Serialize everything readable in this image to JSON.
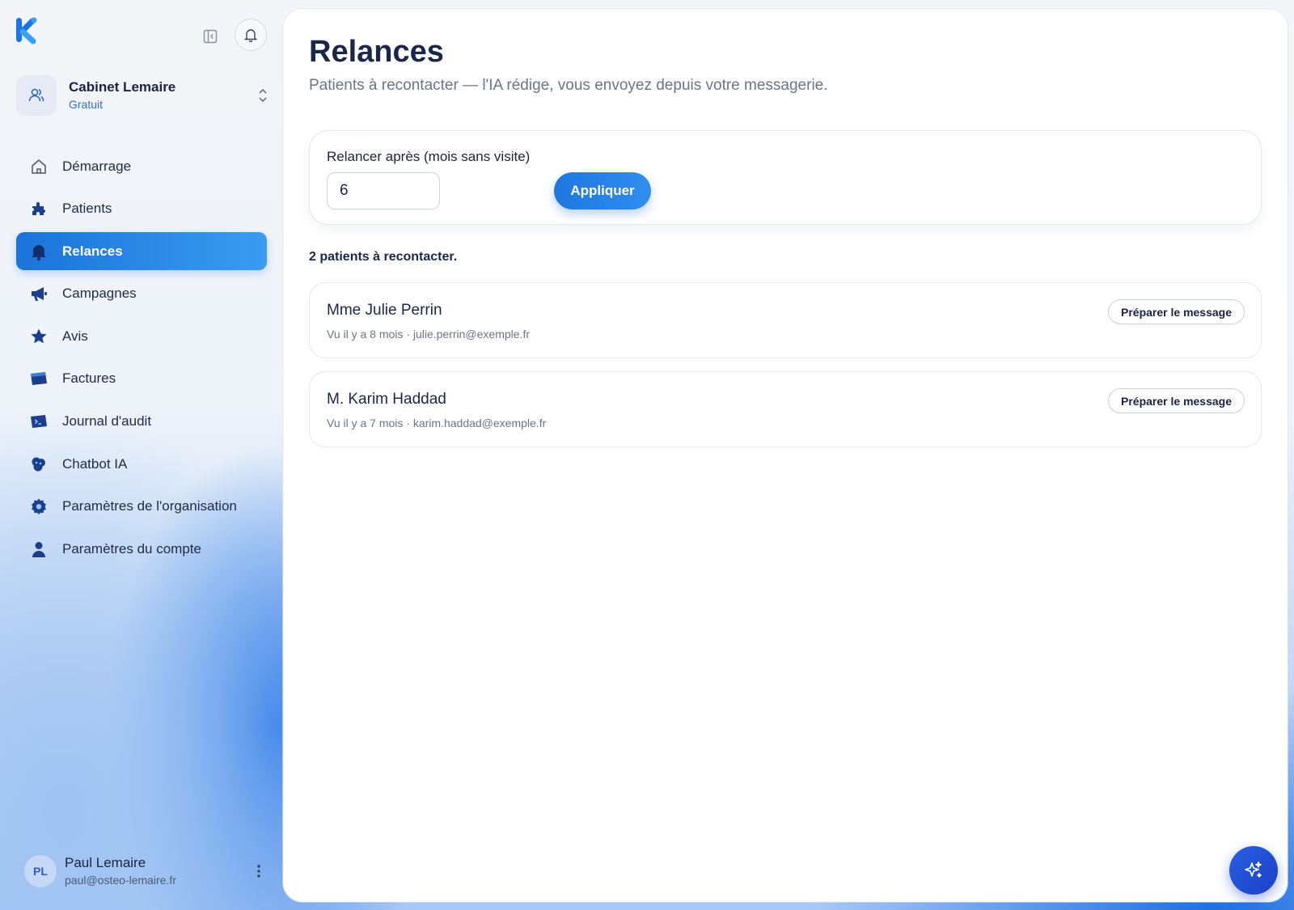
{
  "sidebar": {
    "org": {
      "name": "Cabinet Lemaire",
      "plan": "Gratuit"
    },
    "items": [
      {
        "label": "Démarrage",
        "icon": "home-icon"
      },
      {
        "label": "Patients",
        "icon": "puzzle-icon"
      },
      {
        "label": "Relances",
        "icon": "bell-icon",
        "active": true
      },
      {
        "label": "Campagnes",
        "icon": "megaphone-icon"
      },
      {
        "label": "Avis",
        "icon": "star-icon"
      },
      {
        "label": "Factures",
        "icon": "invoice-icon"
      },
      {
        "label": "Journal d'audit",
        "icon": "terminal-icon"
      },
      {
        "label": "Chatbot IA",
        "icon": "chatbot-icon"
      },
      {
        "label": "Paramètres de l'organisation",
        "icon": "settings-icon"
      },
      {
        "label": "Paramètres du compte",
        "icon": "user-icon"
      }
    ],
    "user": {
      "initials": "PL",
      "name": "Paul Lemaire",
      "email": "paul@osteo-lemaire.fr"
    }
  },
  "main": {
    "title": "Relances",
    "subtitle": "Patients à recontacter — l'IA rédige, vous envoyez depuis votre messagerie.",
    "filter": {
      "label": "Relancer après (mois sans visite)",
      "value": "6",
      "apply_label": "Appliquer"
    },
    "count_text": "2 patients à recontacter.",
    "patients": [
      {
        "name": "Mme Julie Perrin",
        "meta": "Vu il y a 8 mois · julie.perrin@exemple.fr",
        "action": "Préparer le message"
      },
      {
        "name": "M. Karim Haddad",
        "meta": "Vu il y a 7 mois · karim.haddad@exemple.fr",
        "action": "Préparer le message"
      }
    ]
  },
  "colors": {
    "accent": "#1f77e0",
    "nav_icon": "#1b3f8a",
    "brand_logo": "#1a73e8"
  }
}
